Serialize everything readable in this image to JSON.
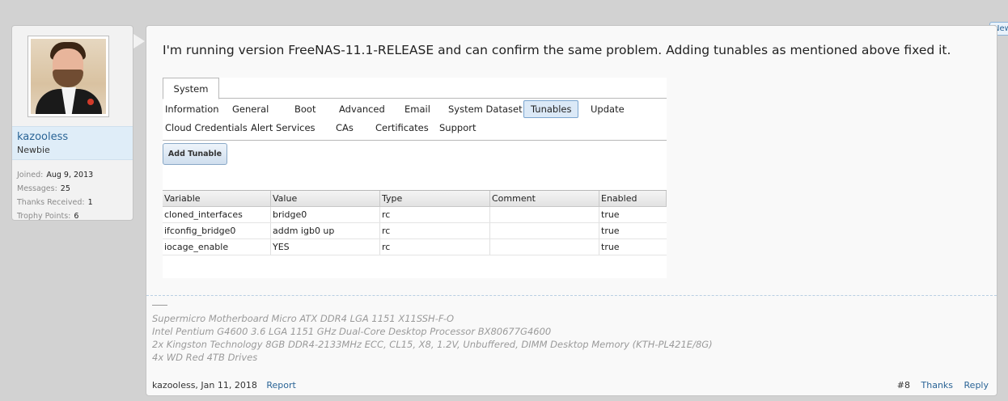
{
  "user": {
    "name": "kazooless",
    "title": "Newbie",
    "stats": [
      {
        "label": "Joined:",
        "value": "Aug 9, 2013"
      },
      {
        "label": "Messages:",
        "value": "25"
      },
      {
        "label": "Thanks Received:",
        "value": "1"
      },
      {
        "label": "Trophy Points:",
        "value": "6"
      }
    ]
  },
  "badge": "New",
  "post": {
    "text": "I'm running version FreeNAS-11.1-RELEASE and can confirm the same problem. Adding tunables as mentioned above fixed it."
  },
  "screenshot": {
    "tab": "System",
    "nav_row1": [
      "Information",
      "General",
      "Boot",
      "Advanced",
      "Email",
      "System Dataset",
      "Tunables",
      "Update"
    ],
    "nav_row2": [
      "Cloud Credentials",
      "Alert Services",
      "CAs",
      "Certificates",
      "Support"
    ],
    "active_item": "Tunables",
    "add_button": "Add Tunable",
    "columns": [
      "Variable",
      "Value",
      "Type",
      "Comment",
      "Enabled"
    ],
    "rows": [
      [
        "cloned_interfaces",
        "bridge0",
        "rc",
        "",
        "true"
      ],
      [
        "ifconfig_bridge0",
        "addm igb0 up",
        "rc",
        "",
        "true"
      ],
      [
        "iocage_enable",
        "YES",
        "rc",
        "",
        "true"
      ]
    ]
  },
  "signature": [
    "Supermicro Motherboard Micro ATX DDR4 LGA 1151 X11SSH-F-O",
    "Intel Pentium G4600 3.6 LGA 1151 GHz Dual-Core Desktop Processor BX80677G4600",
    "2x Kingston Technology 8GB DDR4-2133MHz ECC, CL15, X8, 1.2V, Unbuffered, DIMM Desktop Memory (KTH-PL421E/8G)",
    "4x WD Red 4TB Drives"
  ],
  "footer": {
    "author_date": "kazooless, Jan 11, 2018",
    "report": "Report",
    "post_number": "#8",
    "thanks": "Thanks",
    "reply": "Reply"
  }
}
